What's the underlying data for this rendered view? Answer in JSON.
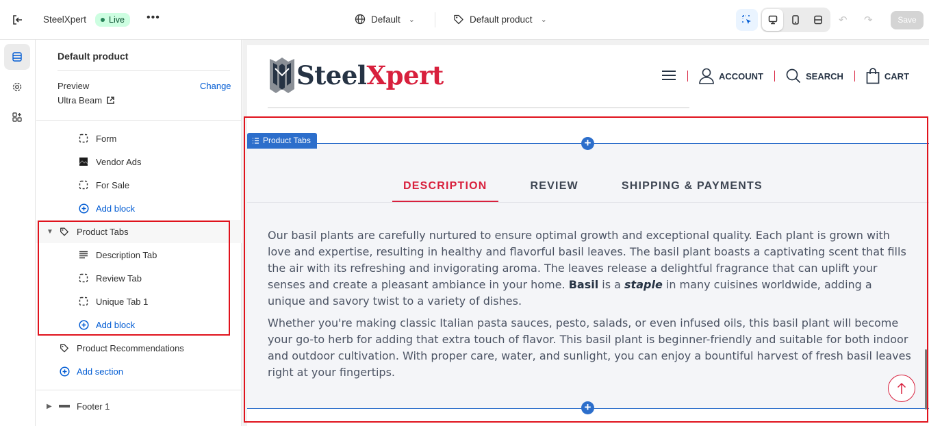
{
  "topbar": {
    "store_name": "SteelXpert",
    "status": "Live",
    "more": "•••",
    "theme_selector": "Default",
    "template_selector": "Default product",
    "save_label": "Save"
  },
  "sidebar": {
    "title": "Default product",
    "preview_label": "Preview",
    "change_label": "Change",
    "preview_theme": "Ultra Beam",
    "items": [
      {
        "label": "Form"
      },
      {
        "label": "Vendor Ads"
      },
      {
        "label": "For Sale"
      },
      {
        "label": "Add block"
      },
      {
        "label": "Product Tabs"
      },
      {
        "label": "Description Tab"
      },
      {
        "label": "Review Tab"
      },
      {
        "label": "Unique Tab 1"
      },
      {
        "label": "Add block"
      },
      {
        "label": "Product Recommendations"
      },
      {
        "label": "Add section"
      },
      {
        "label": "Footer 1"
      }
    ]
  },
  "site": {
    "logo_part1": "Steel",
    "logo_part2": "Xpert",
    "nav": [
      "ACCOUNT",
      "SEARCH",
      "CART"
    ]
  },
  "section": {
    "tag": "Product Tabs",
    "tabs": [
      "DESCRIPTION",
      "REVIEW",
      "SHIPPING & PAYMENTS"
    ],
    "active_tab": "DESCRIPTION",
    "p1_a": "Our basil plants are carefully nurtured to ensure optimal growth and exceptional quality. Each plant is grown with love and expertise, resulting in healthy and flavorful basil leaves. The basil plant boasts a captivating scent that fills the air with its refreshing and invigorating aroma. The leaves release a delightful fragrance that can uplift your senses and create a pleasant ambiance in your home. ",
    "p1_bold": "Basil",
    "p1_b": " is a ",
    "p1_italic": "staple",
    "p1_c": " in many cuisines worldwide, adding a unique and savory twist to a variety of dishes.",
    "p2": "Whether you're making classic Italian pasta sauces, pesto, salads, or even infused oils, this basil plant will become your go-to herb for adding that extra touch of flavor. This basil plant is beginner-friendly and suitable for both indoor and outdoor cultivation. With proper care, water, and sunlight, you can enjoy a bountiful harvest of fresh basil leaves right at your fingertips."
  },
  "colors": {
    "brand_red": "#d8203d",
    "brand_navy": "#263344",
    "editor_blue": "#2c6ecb",
    "link_blue": "#005bd3",
    "highlight_red": "#e0121c"
  }
}
